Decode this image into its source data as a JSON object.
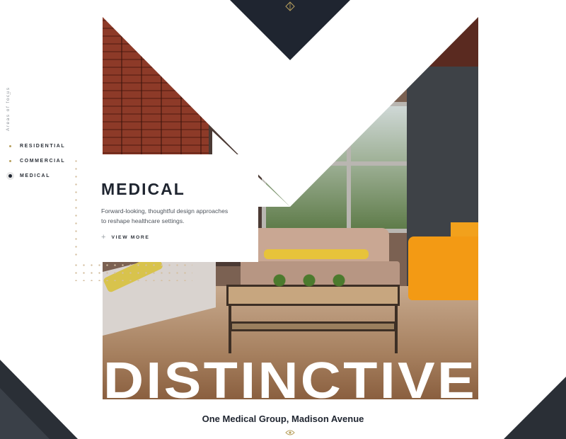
{
  "sidebar": {
    "section_label": "Areas of focus",
    "items": [
      {
        "label": "RESIDENTIAL",
        "active": false
      },
      {
        "label": "COMMERCIAL",
        "active": false
      },
      {
        "label": "MEDICAL",
        "active": true
      }
    ]
  },
  "feature": {
    "title": "MEDICAL",
    "description": "Forward-looking, thoughtful design approaches to reshape healthcare settings.",
    "cta_label": "VIEW MORE",
    "cta_icon": "plus-icon"
  },
  "hero": {
    "headline": "DISTINCTIVE",
    "caption": "One Medical Group, Madison Avenue"
  },
  "icons": {
    "top": "diamond-icon",
    "bottom": "eye-icon"
  },
  "colors": {
    "navy": "#1f2530",
    "gold_accent": "#b8a05e",
    "chair_orange": "#f39a14"
  }
}
